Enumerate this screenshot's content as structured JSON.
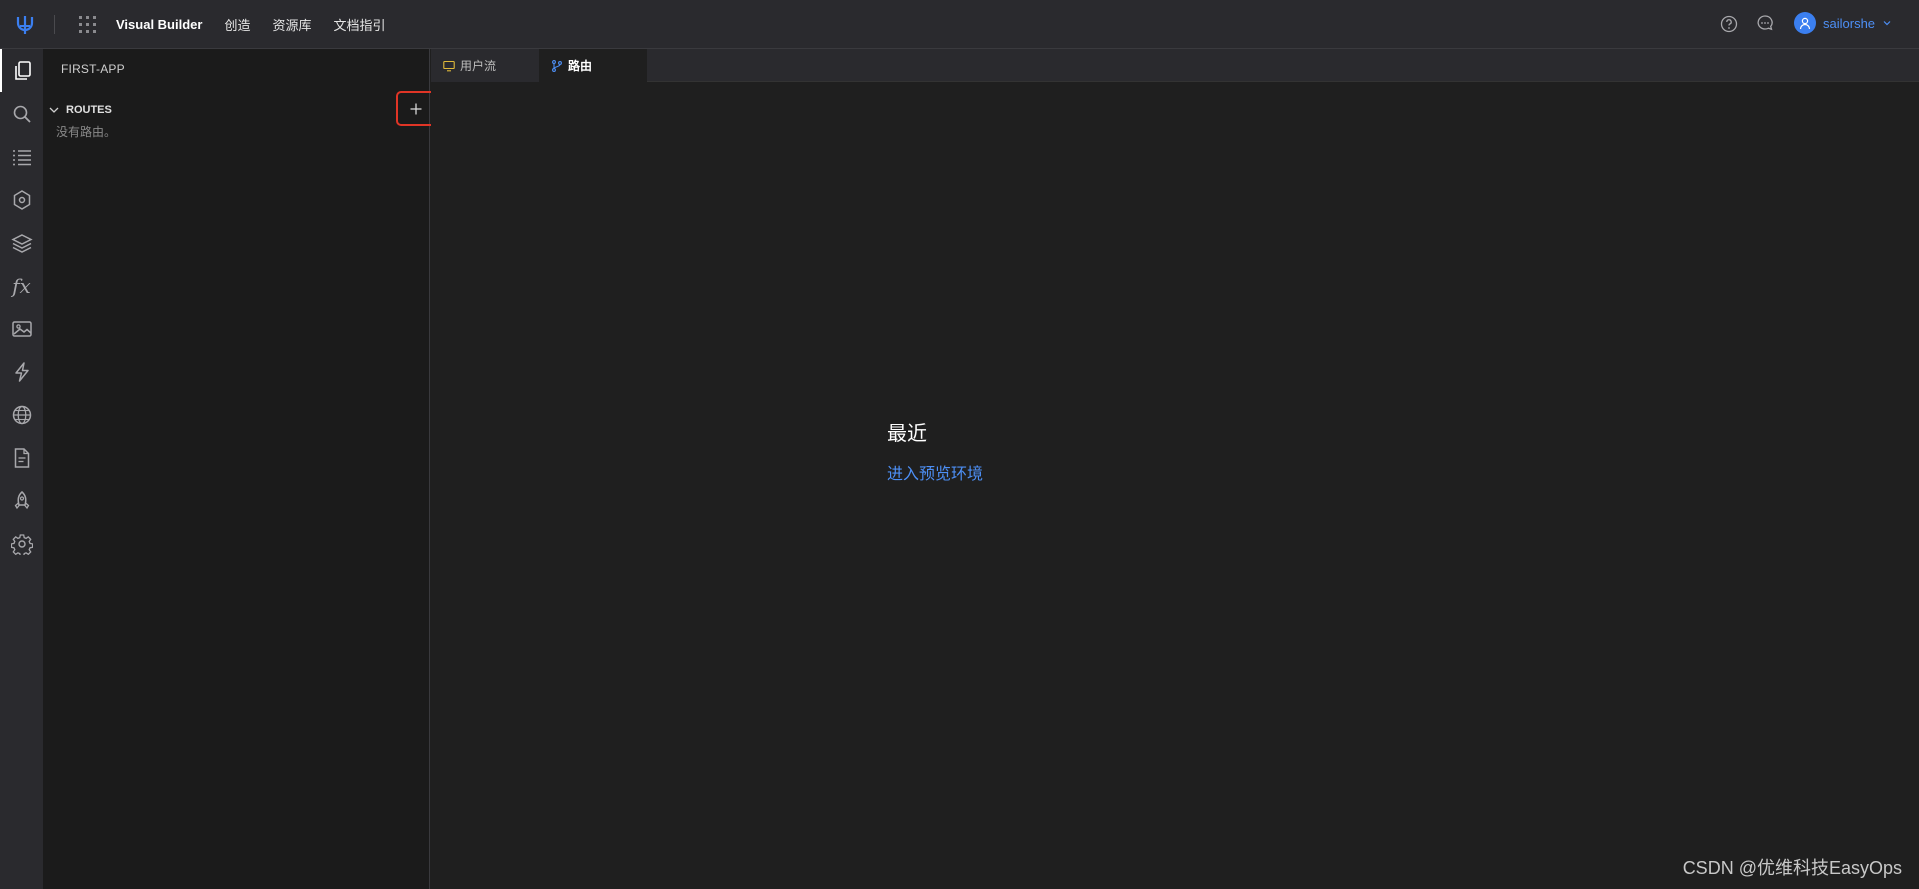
{
  "header": {
    "brand": "Visual Builder",
    "nav": [
      "创造",
      "资源库",
      "文档指引"
    ],
    "user": {
      "name": "sailorshe"
    },
    "icons": [
      "logo-icon",
      "apps-grid-icon",
      "help-icon",
      "chat-icon",
      "user-avatar-icon",
      "chevron-down-icon"
    ]
  },
  "activity_bar": {
    "items": [
      {
        "icon": "pages-icon",
        "active": true
      },
      {
        "icon": "search-icon"
      },
      {
        "icon": "list-icon"
      },
      {
        "icon": "components-icon"
      },
      {
        "icon": "layers-icon"
      },
      {
        "icon": "fx-icon",
        "text": "fx"
      },
      {
        "icon": "image-icon"
      },
      {
        "icon": "lightning-icon"
      },
      {
        "icon": "globe-icon"
      },
      {
        "icon": "document-icon"
      },
      {
        "icon": "rocket-icon"
      },
      {
        "icon": "settings-icon"
      }
    ]
  },
  "sidebar": {
    "title": "FIRST-APP",
    "section": {
      "label": "ROUTES",
      "empty_text": "没有路由。"
    }
  },
  "tabs": [
    {
      "label": "用户流",
      "icon": "monitor-icon",
      "active": false
    },
    {
      "label": "路由",
      "icon": "branch-icon",
      "active": true
    }
  ],
  "main": {
    "title": "最近",
    "link": "进入预览环境"
  },
  "watermark": "CSDN @优维科技EasyOps",
  "colors": {
    "accent": "#4d8ff5",
    "highlight_box": "#e03526",
    "background": "#1f1f1f",
    "topbar": "#2a2a2e"
  }
}
